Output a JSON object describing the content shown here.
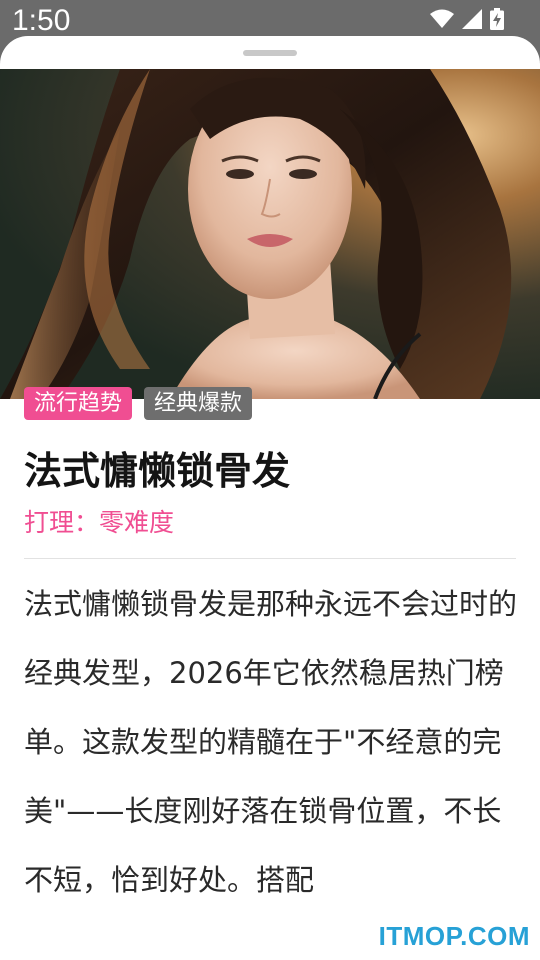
{
  "status_bar": {
    "time": "1:50",
    "icons": [
      "wifi-icon",
      "cellular-signal-icon",
      "battery-charging-icon"
    ]
  },
  "sheet": {
    "hero_image": "woman-with-wavy-collarbone-hair"
  },
  "tags": [
    {
      "label": "流行趋势",
      "color": "#f04e92"
    },
    {
      "label": "经典爆款",
      "color": "#6e6e6e"
    }
  ],
  "title": "法式慵懒锁骨发",
  "care_level": "打理：零难度",
  "description": "法式慵懒锁骨发是那种永远不会过时的经典发型，2026年它依然稳居热门榜单。这款发型的精髓在于\"不经意的完美\"——长度刚好落在锁骨位置，不长不短，恰到好处。搭配",
  "watermark": "ITMOP.COM",
  "colors": {
    "accent": "#f04e92",
    "tag_gray": "#6e6e6e",
    "status_bar": "#6b6b6b",
    "watermark": "#27a1d6"
  }
}
